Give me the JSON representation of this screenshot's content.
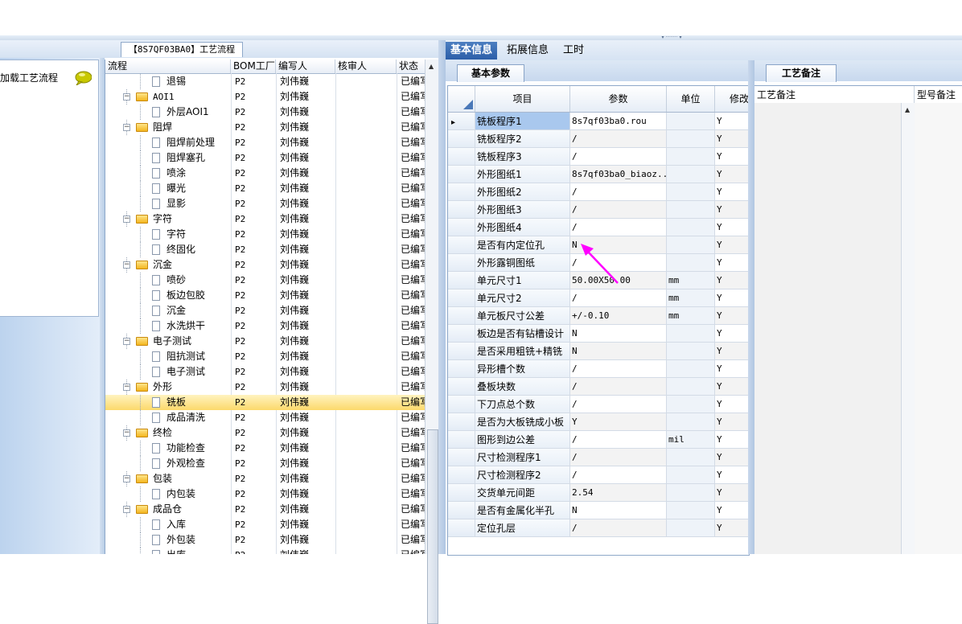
{
  "left": {
    "process_tab": "【8S7QF03BA0】工艺流程",
    "load_item": "加载工艺流程",
    "icons": {
      "comment": "speech-bubble-icon"
    }
  },
  "tree": {
    "columns": [
      "流程",
      "BOM工厂",
      "编写人",
      "核审人",
      "状态"
    ],
    "rows": [
      {
        "label": "退锡",
        "level": 1,
        "bom": "P2",
        "writer": "刘伟巍",
        "status": "已编写"
      },
      {
        "label": "AOI1",
        "level": 0,
        "bom": "P2",
        "writer": "刘伟巍",
        "status": "已编写"
      },
      {
        "label": "外层AOI1",
        "level": 1,
        "bom": "P2",
        "writer": "刘伟巍",
        "status": "已编写"
      },
      {
        "label": "阻焊",
        "level": 0,
        "bom": "P2",
        "writer": "刘伟巍",
        "status": "已编写"
      },
      {
        "label": "阻焊前处理",
        "level": 1,
        "bom": "P2",
        "writer": "刘伟巍",
        "status": "已编写"
      },
      {
        "label": "阻焊塞孔",
        "level": 1,
        "bom": "P2",
        "writer": "刘伟巍",
        "status": "已编写"
      },
      {
        "label": "喷涂",
        "level": 1,
        "bom": "P2",
        "writer": "刘伟巍",
        "status": "已编写"
      },
      {
        "label": "曝光",
        "level": 1,
        "bom": "P2",
        "writer": "刘伟巍",
        "status": "已编写"
      },
      {
        "label": "显影",
        "level": 1,
        "bom": "P2",
        "writer": "刘伟巍",
        "status": "已编写"
      },
      {
        "label": "字符",
        "level": 0,
        "bom": "P2",
        "writer": "刘伟巍",
        "status": "已编写"
      },
      {
        "label": "字符",
        "level": 1,
        "bom": "P2",
        "writer": "刘伟巍",
        "status": "已编写"
      },
      {
        "label": "终固化",
        "level": 1,
        "bom": "P2",
        "writer": "刘伟巍",
        "status": "已编写"
      },
      {
        "label": "沉金",
        "level": 0,
        "bom": "P2",
        "writer": "刘伟巍",
        "status": "已编写"
      },
      {
        "label": "喷砂",
        "level": 1,
        "bom": "P2",
        "writer": "刘伟巍",
        "status": "已编写"
      },
      {
        "label": "板边包胶",
        "level": 1,
        "bom": "P2",
        "writer": "刘伟巍",
        "status": "已编写"
      },
      {
        "label": "沉金",
        "level": 1,
        "bom": "P2",
        "writer": "刘伟巍",
        "status": "已编写"
      },
      {
        "label": "水洗烘干",
        "level": 1,
        "bom": "P2",
        "writer": "刘伟巍",
        "status": "已编写"
      },
      {
        "label": "电子测试",
        "level": 0,
        "bom": "P2",
        "writer": "刘伟巍",
        "status": "已编写"
      },
      {
        "label": "阻抗测试",
        "level": 1,
        "bom": "P2",
        "writer": "刘伟巍",
        "status": "已编写"
      },
      {
        "label": "电子测试",
        "level": 1,
        "bom": "P2",
        "writer": "刘伟巍",
        "status": "已编写"
      },
      {
        "label": "外形",
        "level": 0,
        "bom": "P2",
        "writer": "刘伟巍",
        "status": "已编写"
      },
      {
        "label": "铣板",
        "level": 1,
        "bom": "P2",
        "writer": "刘伟巍",
        "status": "已编写",
        "selected": true
      },
      {
        "label": "成品清洗",
        "level": 1,
        "bom": "P2",
        "writer": "刘伟巍",
        "status": "已编写"
      },
      {
        "label": "终检",
        "level": 0,
        "bom": "P2",
        "writer": "刘伟巍",
        "status": "已编写"
      },
      {
        "label": "功能检查",
        "level": 1,
        "bom": "P2",
        "writer": "刘伟巍",
        "status": "已编写"
      },
      {
        "label": "外观检查",
        "level": 1,
        "bom": "P2",
        "writer": "刘伟巍",
        "status": "已编写"
      },
      {
        "label": "包装",
        "level": 0,
        "bom": "P2",
        "writer": "刘伟巍",
        "status": "已编写"
      },
      {
        "label": "内包装",
        "level": 1,
        "bom": "P2",
        "writer": "刘伟巍",
        "status": "已编写"
      },
      {
        "label": "成品仓",
        "level": 0,
        "bom": "P2",
        "writer": "刘伟巍",
        "status": "已编写"
      },
      {
        "label": "入库",
        "level": 1,
        "bom": "P2",
        "writer": "刘伟巍",
        "status": "已编写"
      },
      {
        "label": "外包装",
        "level": 1,
        "bom": "P2",
        "writer": "刘伟巍",
        "status": "已编写"
      },
      {
        "label": "出库",
        "level": 1,
        "bom": "P2",
        "writer": "刘伟巍",
        "status": "已编写"
      }
    ]
  },
  "middle": {
    "tabs": [
      {
        "label": "基本信息",
        "active": true
      },
      {
        "label": "拓展信息",
        "active": false
      },
      {
        "label": "工时",
        "active": false
      }
    ],
    "subtab": "基本参数",
    "columns": [
      "项目",
      "参数",
      "单位",
      "修改"
    ],
    "rows": [
      {
        "name": "铣板程序1",
        "value": "8s7qf03ba0.rou",
        "unit": "",
        "mod": "Y",
        "current": true
      },
      {
        "name": "铣板程序2",
        "value": "/",
        "unit": "",
        "mod": "Y"
      },
      {
        "name": "铣板程序3",
        "value": "/",
        "unit": "",
        "mod": "Y"
      },
      {
        "name": "外形图纸1",
        "value": "8s7qf03ba0_biaoz...",
        "unit": "",
        "mod": "Y"
      },
      {
        "name": "外形图纸2",
        "value": "/",
        "unit": "",
        "mod": "Y"
      },
      {
        "name": "外形图纸3",
        "value": "/",
        "unit": "",
        "mod": "Y"
      },
      {
        "name": "外形图纸4",
        "value": "/",
        "unit": "",
        "mod": "Y"
      },
      {
        "name": "是否有内定位孔",
        "value": "N",
        "unit": "",
        "mod": "Y"
      },
      {
        "name": "外形露铜图纸",
        "value": "/",
        "unit": "",
        "mod": "Y"
      },
      {
        "name": "单元尺寸1",
        "value": "50.00X50.00",
        "unit": "mm",
        "mod": "Y"
      },
      {
        "name": "单元尺寸2",
        "value": "/",
        "unit": "mm",
        "mod": "Y"
      },
      {
        "name": "单元板尺寸公差",
        "value": "+/-0.10",
        "unit": "mm",
        "mod": "Y"
      },
      {
        "name": "板边是否有钻槽设计",
        "value": "N",
        "unit": "",
        "mod": "Y"
      },
      {
        "name": "是否采用粗铣+精铣",
        "value": "N",
        "unit": "",
        "mod": "Y"
      },
      {
        "name": "异形槽个数",
        "value": "/",
        "unit": "",
        "mod": "Y"
      },
      {
        "name": "叠板块数",
        "value": "/",
        "unit": "",
        "mod": "Y"
      },
      {
        "name": "下刀点总个数",
        "value": "/",
        "unit": "",
        "mod": "Y"
      },
      {
        "name": "是否为大板铣成小板",
        "value": "Y",
        "unit": "",
        "mod": "Y"
      },
      {
        "name": "图形到边公差",
        "value": "/",
        "unit": "mil",
        "mod": "Y"
      },
      {
        "name": "尺寸检测程序1",
        "value": "/",
        "unit": "",
        "mod": "Y"
      },
      {
        "name": "尺寸检测程序2",
        "value": "/",
        "unit": "",
        "mod": "Y"
      },
      {
        "name": "交货单元间距",
        "value": "2.54",
        "unit": "",
        "mod": "Y"
      },
      {
        "name": "是否有金属化半孔",
        "value": "N",
        "unit": "",
        "mod": "Y"
      },
      {
        "name": "定位孔层",
        "value": "/",
        "unit": "",
        "mod": "Y"
      }
    ]
  },
  "right": {
    "tab": "工艺备注",
    "col1": "工艺备注",
    "col2": "型号备注"
  },
  "colors": {
    "accent": "#2c5ea8",
    "selection": "#fcd96b",
    "annotation_arrow": "#ff00ff"
  }
}
